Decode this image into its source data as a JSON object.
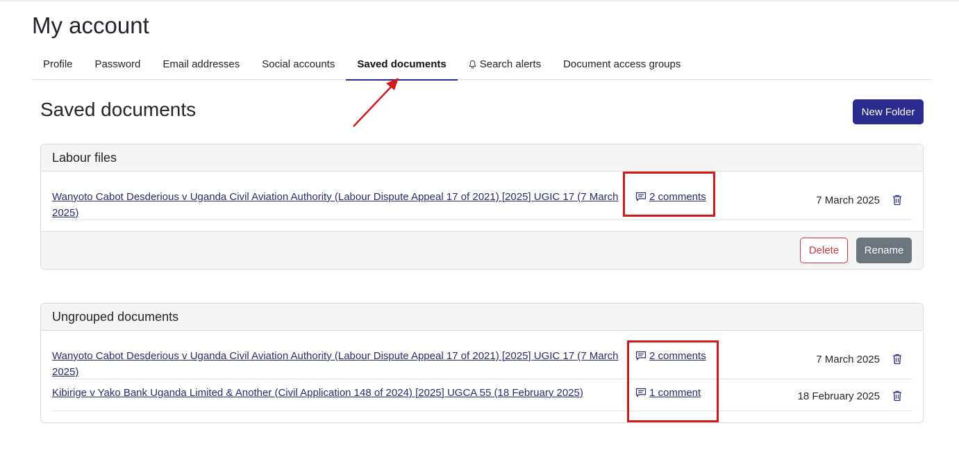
{
  "page": {
    "title": "My account"
  },
  "tabs": [
    {
      "label": "Profile",
      "active": false
    },
    {
      "label": "Password",
      "active": false
    },
    {
      "label": "Email addresses",
      "active": false
    },
    {
      "label": "Social accounts",
      "active": false
    },
    {
      "label": "Saved documents",
      "active": true
    },
    {
      "label": "Search alerts",
      "active": false,
      "icon": "bell-icon"
    },
    {
      "label": "Document access groups",
      "active": false
    }
  ],
  "section": {
    "title": "Saved documents",
    "new_folder_label": "New Folder"
  },
  "folders": [
    {
      "name": "Labour files",
      "documents": [
        {
          "title": "Wanyoto Cabot Desderious v Uganda Civil Aviation Authority (Labour Dispute Appeal 17 of 2021) [2025] UGIC 17 (7 March 2025)",
          "comments": "2 comments",
          "date": "7 March 2025"
        }
      ],
      "delete_label": "Delete",
      "rename_label": "Rename"
    }
  ],
  "ungrouped": {
    "name": "Ungrouped documents",
    "documents": [
      {
        "title": "Wanyoto Cabot Desderious v Uganda Civil Aviation Authority (Labour Dispute Appeal 17 of 2021) [2025] UGIC 17 (7 March 2025)",
        "comments": "2 comments",
        "date": "7 March 2025"
      },
      {
        "title": "Kibirige v Yako Bank Uganda Limited & Another (Civil Application 148 of 2024) [2025] UGCA 55 (18 February 2025)",
        "comments": "1 comment",
        "date": "18 February 2025"
      }
    ]
  },
  "colors": {
    "primary": "#2a2b8f",
    "link": "#2a2b6f",
    "danger": "#d0363f",
    "secondary": "#6c757d",
    "annotation": "#d11a1a"
  }
}
